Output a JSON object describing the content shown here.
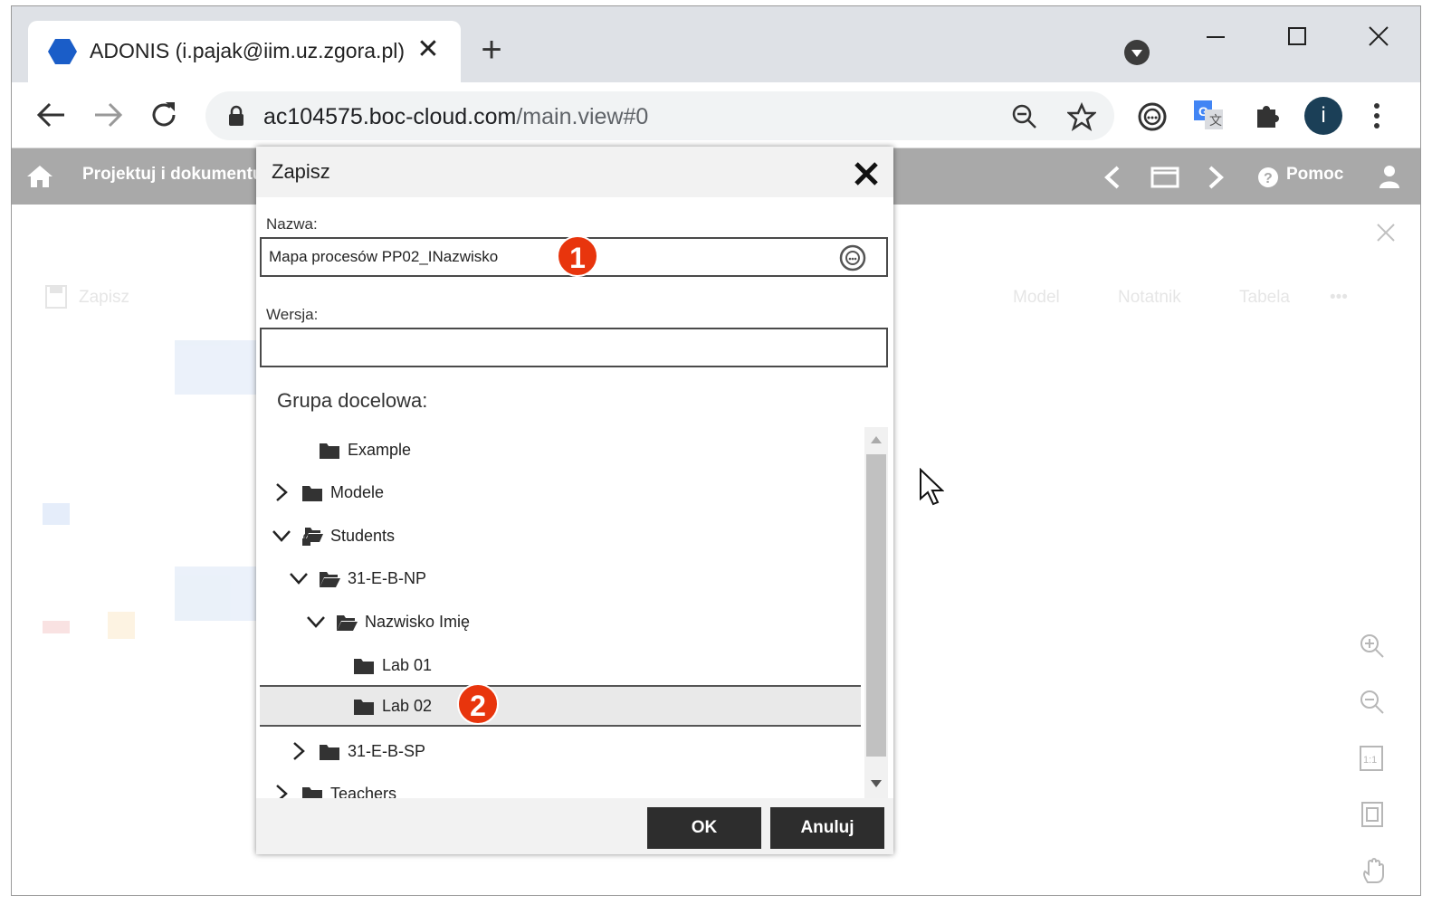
{
  "browser": {
    "tab_title": "ADONIS (i.pajak@iim.uz.zgora.pl)",
    "url_host": "ac104575.boc-cloud.com",
    "url_path": "/main.view#0",
    "profile_initial": "i",
    "new_tab": "+",
    "tab_close": "✕"
  },
  "appbar": {
    "title": "Projektuj i dokumentuj",
    "help": "Pomoc"
  },
  "background": {
    "save": "Zapisz",
    "tabs": [
      "Model",
      "Notatnik",
      "Tabela"
    ],
    "more": "•••"
  },
  "dialog": {
    "title": "Zapisz",
    "name_label": "Nazwa:",
    "name_value": "Mapa procesów PP02_INazwisko",
    "version_label": "Wersja:",
    "version_value": "",
    "group_label": "Grupa docelowa:",
    "tree": [
      {
        "label": "Example",
        "expander": "none",
        "icon": "folder-icon"
      },
      {
        "label": "Modele",
        "expander": "collapsed",
        "icon": "folder-icon"
      },
      {
        "label": "Students",
        "expander": "expanded",
        "icon": "folder-open-locked-icon"
      },
      {
        "label": "31-E-B-NP",
        "expander": "expanded",
        "icon": "folder-open-icon"
      },
      {
        "label": "Nazwisko Imię",
        "expander": "expanded",
        "icon": "folder-open-icon"
      },
      {
        "label": "Lab 01",
        "expander": "none",
        "icon": "folder-icon"
      },
      {
        "label": "Lab 02",
        "expander": "none",
        "icon": "folder-icon",
        "selected": true
      },
      {
        "label": "31-E-B-SP",
        "expander": "collapsed",
        "icon": "folder-icon"
      },
      {
        "label": "Teachers",
        "expander": "collapsed",
        "icon": "folder-icon"
      }
    ],
    "ok_label": "OK",
    "cancel_label": "Anuluj"
  },
  "annotations": {
    "badge_1": "1",
    "badge_2": "2"
  },
  "colors": {
    "badge": "#e8350d",
    "appbar": "#a9a9a9",
    "button": "#2d2d2d"
  }
}
